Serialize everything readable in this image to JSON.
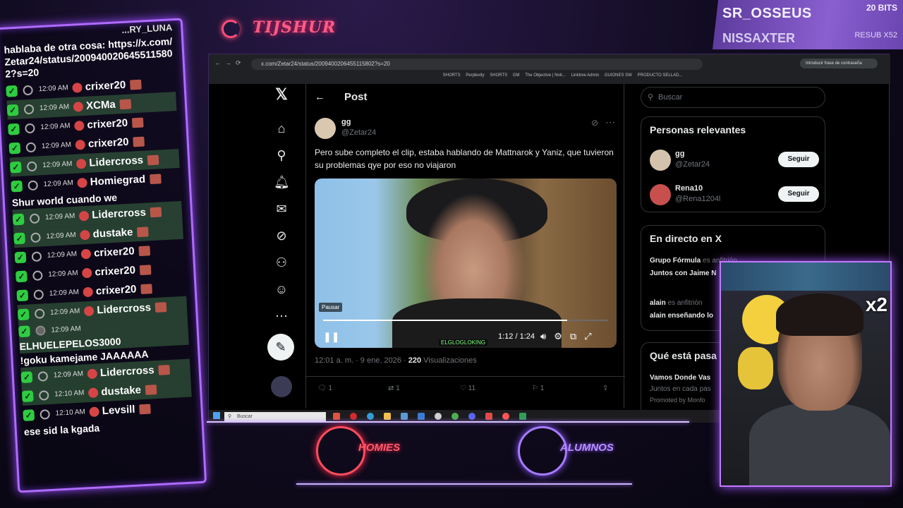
{
  "overlay": {
    "logo_text": "TIJSHUR",
    "top_user_1": "SR_OSSEUS",
    "top_user_1_badge": "20 BITS",
    "top_user_2": "NISSAXTER",
    "top_user_2_badge": "RESUB X52",
    "webcam_multiplier": "x2",
    "team_left": "HOMIES",
    "team_right": "ALUMNOS",
    "colors": {
      "accent_purple": "#b06bff",
      "accent_pink": "#ff4d7a",
      "chat_highlight": "#2ecc40"
    }
  },
  "chat": {
    "header_fragment": "...RY_LUNA",
    "first_message": "hablaba de otra cosa: https://x.com/Zetar24/status/2009400206455115802?s=20",
    "rows": [
      {
        "time": "12:09 AM",
        "user": "crixer20",
        "highlight": false
      },
      {
        "time": "12:09 AM",
        "user": "XCMa",
        "highlight": true
      },
      {
        "time": "12:09 AM",
        "user": "crixer20",
        "highlight": false
      },
      {
        "time": "12:09 AM",
        "user": "crixer20",
        "highlight": false
      },
      {
        "time": "12:09 AM",
        "user": "Lidercross",
        "highlight": true
      },
      {
        "time": "12:09 AM",
        "user": "Homiegrad",
        "highlight": false
      }
    ],
    "msg_homiegrad": "Shur world cuando we",
    "rows2": [
      {
        "time": "12:09 AM",
        "user": "Lidercross",
        "highlight": true
      },
      {
        "time": "12:09 AM",
        "user": "dustake",
        "highlight": true
      },
      {
        "time": "12:09 AM",
        "user": "crixer20",
        "highlight": false
      },
      {
        "time": "12:09 AM",
        "user": "crixer20",
        "highlight": false
      },
      {
        "time": "12:09 AM",
        "user": "crixer20",
        "highlight": false
      },
      {
        "time": "12:09 AM",
        "user": "Lidercross",
        "highlight": true
      }
    ],
    "row_el": {
      "time": "12:09 AM",
      "user": "ELHUELEPELOS3000"
    },
    "msg_el": "!goku kamejame JAAAAAA",
    "rows3": [
      {
        "time": "12:09 AM",
        "user": "Lidercross",
        "highlight": true
      },
      {
        "time": "12:10 AM",
        "user": "dustake",
        "highlight": true
      },
      {
        "time": "12:10 AM",
        "user": "Levsill",
        "highlight": false
      }
    ],
    "msg_levsill": "ese sid la kgada"
  },
  "browser": {
    "url": "x.com/Zetar24/status/2009400206455115802?s=20",
    "bookmarks": [
      "SHORTS",
      "Perplexity",
      "SHORTS",
      "GM",
      "The Objective | Noti...",
      "Linktree Admin",
      "GUIONES SW",
      "PRODUCTO SELLAD..."
    ],
    "password_prompt": "Introducir frase de contraseña"
  },
  "x": {
    "page_title": "Post",
    "author_name": "gg",
    "author_handle": "@Zetar24",
    "tweet_text": "Pero sube completo el clip, estaba hablando de Mattnarok y Yaniz, que tuvieron su problemas qye por eso no viajaron",
    "video": {
      "tooltip": "Pausar",
      "time": "1:12 / 1:24",
      "progress": 0.857,
      "watermark": "ELGLOGLOKING"
    },
    "meta_time": "12:01 a. m. · 9 ene. 2026 · ",
    "meta_views_count": "220",
    "meta_views_label": " Visualizaciones",
    "actions": {
      "replies": "1",
      "reposts": "1",
      "likes": "11",
      "bookmarks": "1"
    },
    "search_placeholder": "Buscar",
    "relevant_title": "Personas relevantes",
    "relevant": [
      {
        "name": "gg",
        "handle": "@Zetar24",
        "button": "Seguir"
      },
      {
        "name": "Rena10",
        "handle": "@Rena1204l",
        "button": "Seguir"
      }
    ],
    "live_title": "En directo en X",
    "live": [
      {
        "host": "Grupo Fórmula",
        "role": "es anfitrión",
        "title": "Juntos con Jaime N"
      },
      {
        "host": "alain",
        "role": "es anfitrión",
        "title": "alain enseñando lo"
      }
    ],
    "trending_title": "Qué está pasa",
    "trending_item": "Vamos Donde Vas",
    "trending_sub": "Juntos en cada pas",
    "promoted": "Promoted by Monfo"
  },
  "taskbar": {
    "search_placeholder": "Buscar"
  }
}
